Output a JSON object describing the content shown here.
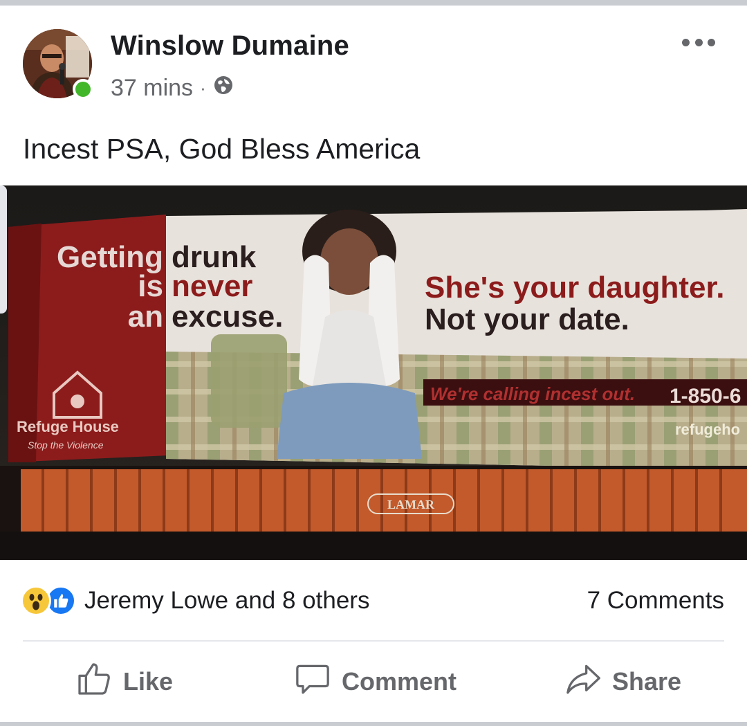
{
  "post": {
    "author": "Winslow Dumaine",
    "time": "37 mins",
    "separator": "·",
    "privacy_icon": "globe-icon",
    "text": "Incest PSA, God Bless America"
  },
  "photo": {
    "billboard_left": [
      "Getting",
      "drunk",
      "is",
      "never",
      "an",
      "excuse."
    ],
    "headline_line1": "She's your daughter.",
    "headline_line2": "Not your date.",
    "banner": "We're calling incest out.",
    "phone": "1-850-6",
    "web": "refugeho",
    "org": "Refuge House",
    "org_tagline": "Stop the Violence",
    "brand": "LAMAR"
  },
  "reactions": {
    "icons": [
      "wow-icon",
      "like-icon"
    ],
    "summary": "Jeremy Lowe and 8 others",
    "comments": "7 Comments"
  },
  "actions": {
    "like": "Like",
    "comment": "Comment",
    "share": "Share"
  },
  "colors": {
    "name_text": "#1c1e21",
    "meta_text": "#65676b",
    "online": "#42b72a",
    "like_blue": "#1877f2",
    "wow_yellow": "#f7c73a",
    "billboard_red": "#8c1c1c"
  }
}
